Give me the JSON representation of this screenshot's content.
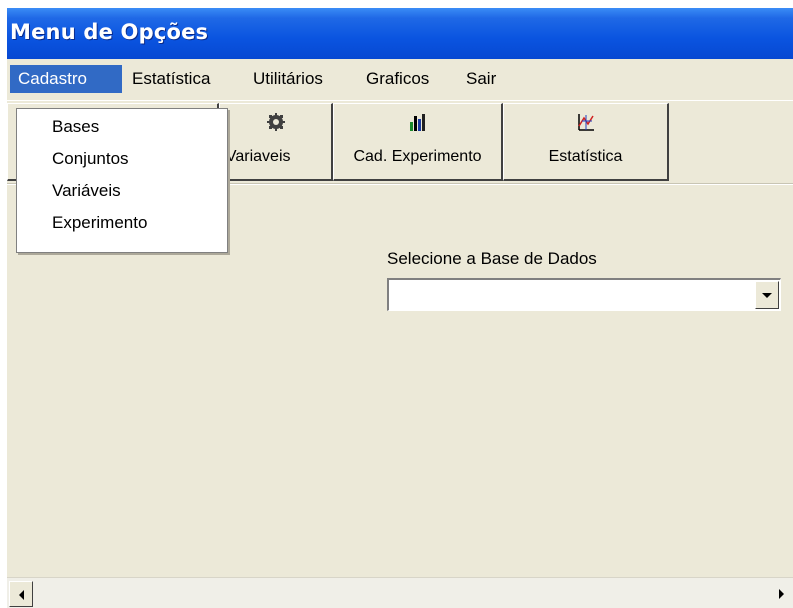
{
  "window": {
    "title": "Menu de Opções"
  },
  "menubar": {
    "items": [
      {
        "label": "Cadastro",
        "active": true
      },
      {
        "label": "Estatística"
      },
      {
        "label": "Utilitários"
      },
      {
        "label": "Graficos"
      },
      {
        "label": "Sair"
      }
    ]
  },
  "toolbar": {
    "buttons": [
      {
        "label": ". Variaveis",
        "icon": "gear-icon"
      },
      {
        "label": "Cad. Experimento",
        "icon": "bar-chart-icon"
      },
      {
        "label": "Estatística",
        "icon": "stats-chart-icon"
      }
    ]
  },
  "dropdown": {
    "items": [
      {
        "label": "Bases"
      },
      {
        "label": "Conjuntos"
      },
      {
        "label": "Variáveis"
      },
      {
        "label": "Experimento"
      }
    ]
  },
  "database": {
    "label": "Selecione a Base de Dados",
    "value": ""
  },
  "colors": {
    "titlebar": "#0a54e0",
    "menu_highlight": "#316ac5",
    "window_bg": "#ece9d8"
  }
}
